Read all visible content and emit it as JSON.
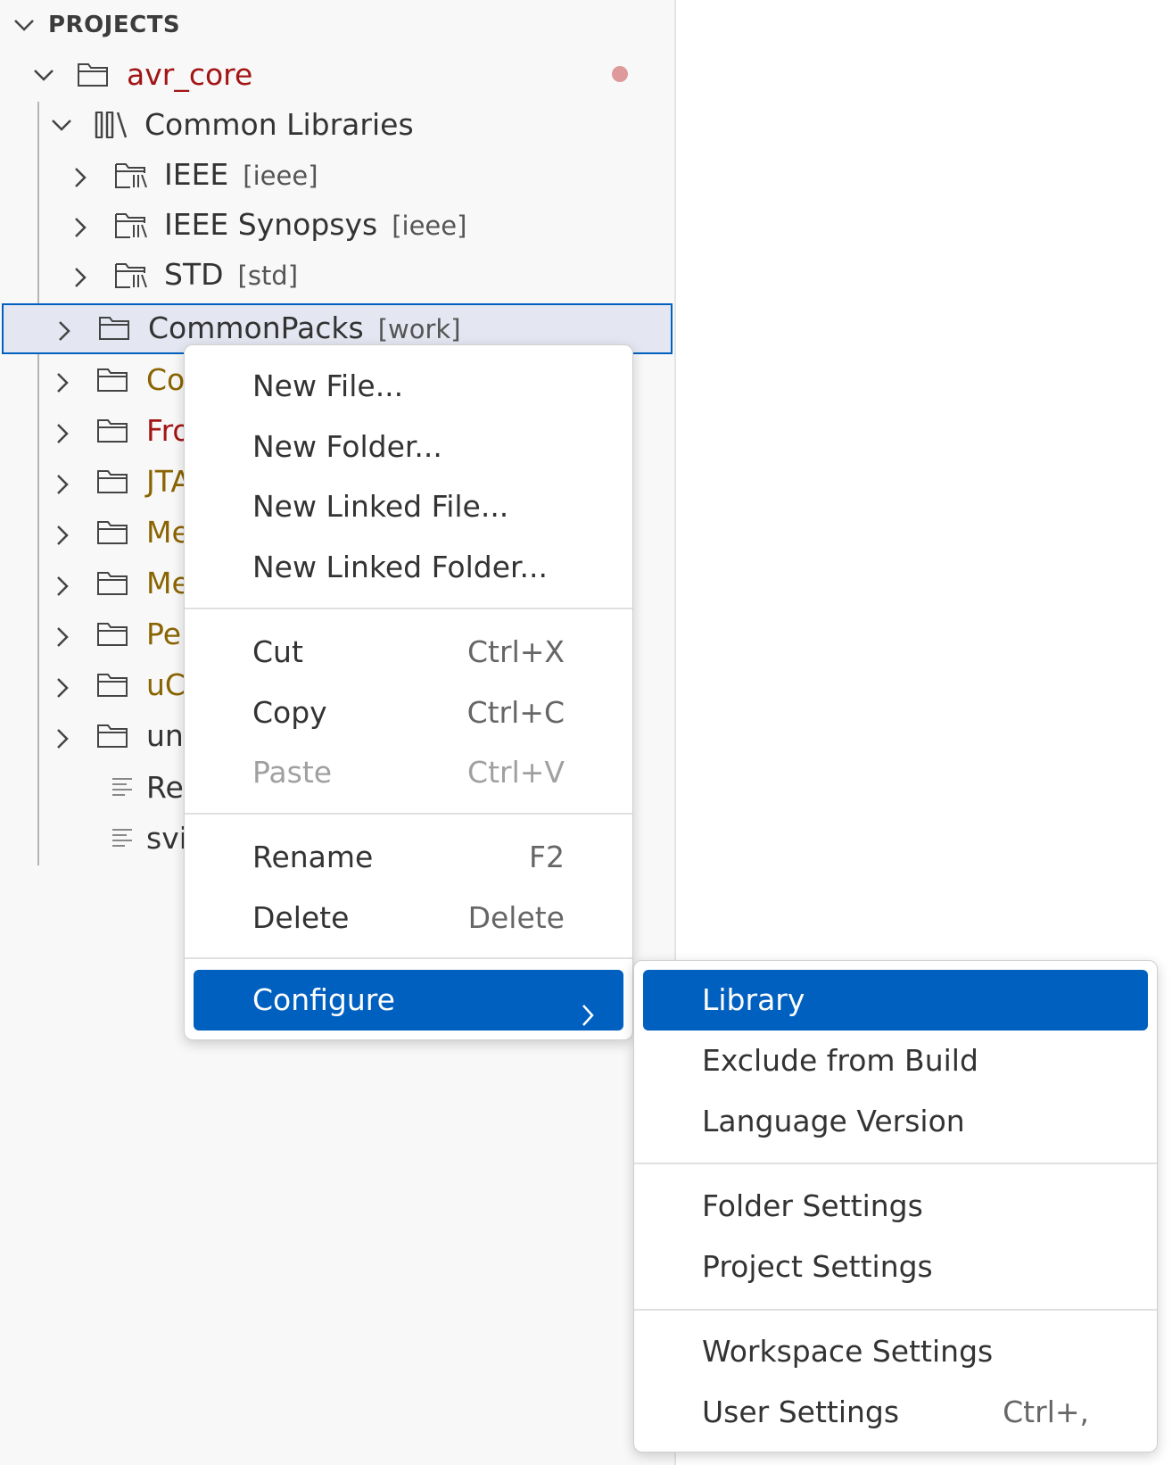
{
  "explorer": {
    "section_title": "PROJECTS",
    "project": {
      "name": "avr_core"
    },
    "common_libraries": {
      "label": "Common Libraries",
      "items": [
        {
          "label": "IEEE",
          "suffix": "[ieee]"
        },
        {
          "label": "IEEE Synopsys",
          "suffix": "[ieee]"
        },
        {
          "label": "STD",
          "suffix": "[std]"
        }
      ]
    },
    "folders": [
      {
        "label": "CommonPacks",
        "suffix": "[work]"
      },
      {
        "label": "Co"
      },
      {
        "label": "Fro"
      },
      {
        "label": "JTA"
      },
      {
        "label": "Me"
      },
      {
        "label": "Me"
      },
      {
        "label": "Pe"
      },
      {
        "label": "uC"
      },
      {
        "label": "un"
      }
    ],
    "files": [
      {
        "label": "Re"
      },
      {
        "label": "svi"
      }
    ]
  },
  "context_menu": {
    "new_file": "New File...",
    "new_folder": "New Folder...",
    "new_linked_file": "New Linked File...",
    "new_linked_folder": "New Linked Folder...",
    "cut": {
      "label": "Cut",
      "shortcut": "Ctrl+X"
    },
    "copy": {
      "label": "Copy",
      "shortcut": "Ctrl+C"
    },
    "paste": {
      "label": "Paste",
      "shortcut": "Ctrl+V"
    },
    "rename": {
      "label": "Rename",
      "shortcut": "F2"
    },
    "delete": {
      "label": "Delete",
      "shortcut": "Delete"
    },
    "configure": "Configure"
  },
  "submenu": {
    "library": "Library",
    "exclude_from_build": "Exclude from Build",
    "language_version": "Language Version",
    "folder_settings": "Folder Settings",
    "project_settings": "Project Settings",
    "workspace_settings": "Workspace Settings",
    "user_settings": {
      "label": "User Settings",
      "shortcut": "Ctrl+,"
    }
  },
  "colors": {
    "accent": "#0060c0",
    "selection_bg": "#e4e6f1",
    "error_red": "#a31515",
    "modified_gold": "#8a6400",
    "dirty_dot": "#de9a9a"
  }
}
